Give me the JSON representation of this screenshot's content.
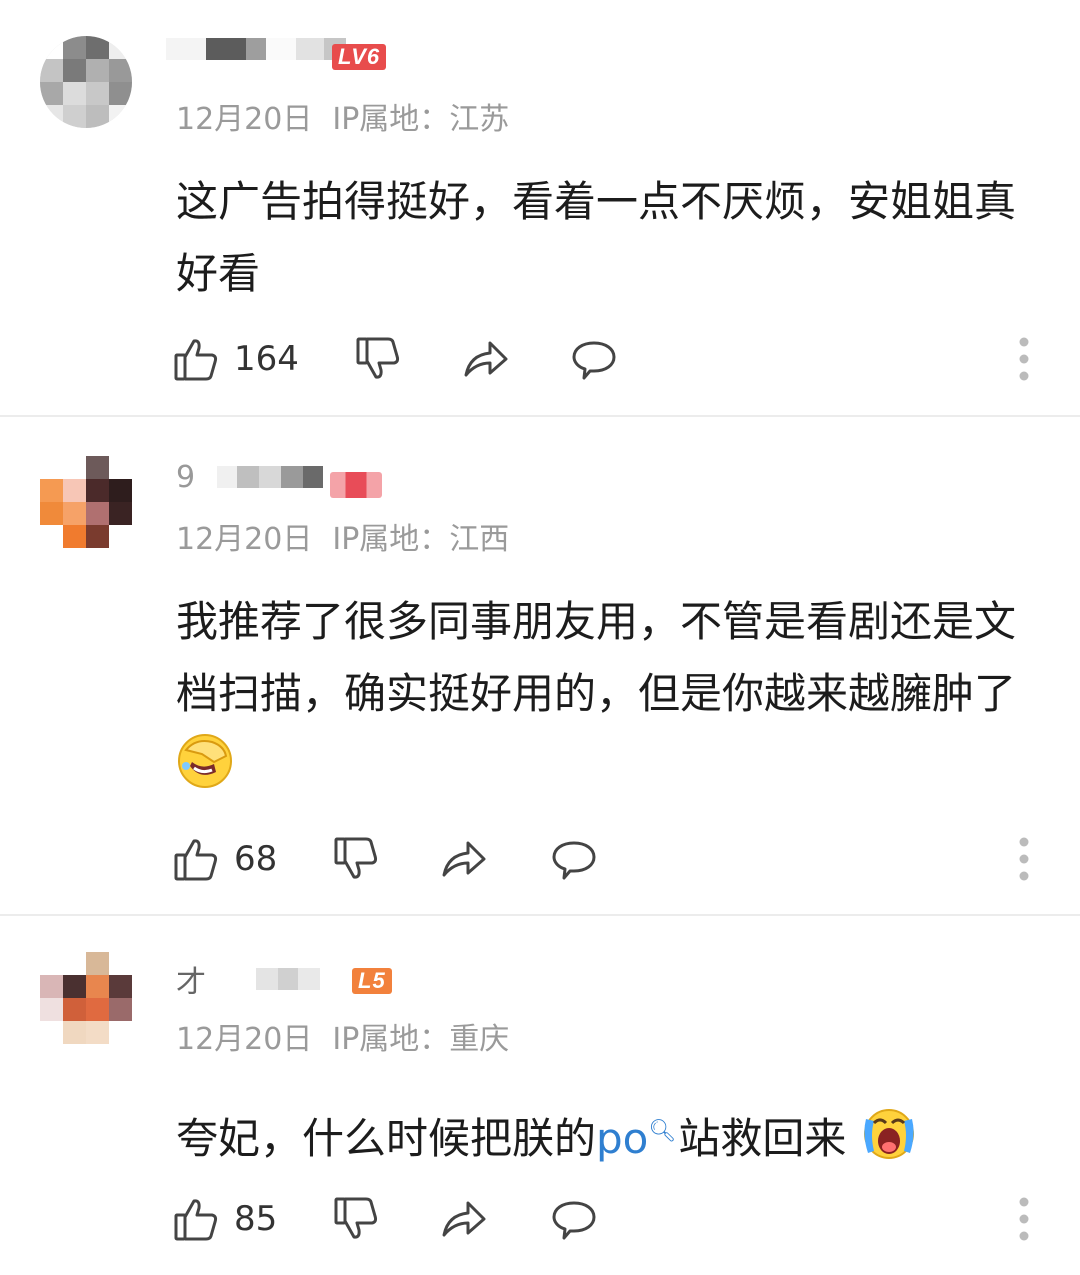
{
  "comments": [
    {
      "username_prefix": "",
      "level_badge": "LV6",
      "badge_color": "#e84c4c",
      "date": "12月20日",
      "ip": "IP属地：江苏",
      "text": "这广告拍得挺好，看着一点不厌烦，安姐姐真好看",
      "likes": "164"
    },
    {
      "username_prefix": "9",
      "level_badge": "",
      "badge_color": "#f08a90",
      "date": "12月20日",
      "ip": "IP属地：江西",
      "text_main": "我推荐了很多同事朋友用，不管是看剧还是文档扫描，确实挺好用的，但是你越来越臃肿了",
      "emoji": "laughing-covering-face-emoji",
      "likes": "68"
    },
    {
      "username_prefix": "才",
      "level_badge": "L5",
      "badge_color": "#f2813c",
      "date": "12月20日",
      "ip": "IP属地：重庆",
      "text_before": "夸妃，什么时候把朕的",
      "text_link": "po",
      "text_after": "站救回来",
      "emoji": "crying-face-emoji",
      "likes": "85"
    }
  ],
  "icons": {
    "like": "thumbs-up-icon",
    "dislike": "thumbs-down-icon",
    "share": "share-arrow-icon",
    "reply": "comment-bubble-icon",
    "more": "more-vertical-icon",
    "search": "search-icon"
  },
  "colors": {
    "link": "#2f7fd0",
    "meta_text": "#9a9a9a",
    "divider": "#ececec"
  }
}
